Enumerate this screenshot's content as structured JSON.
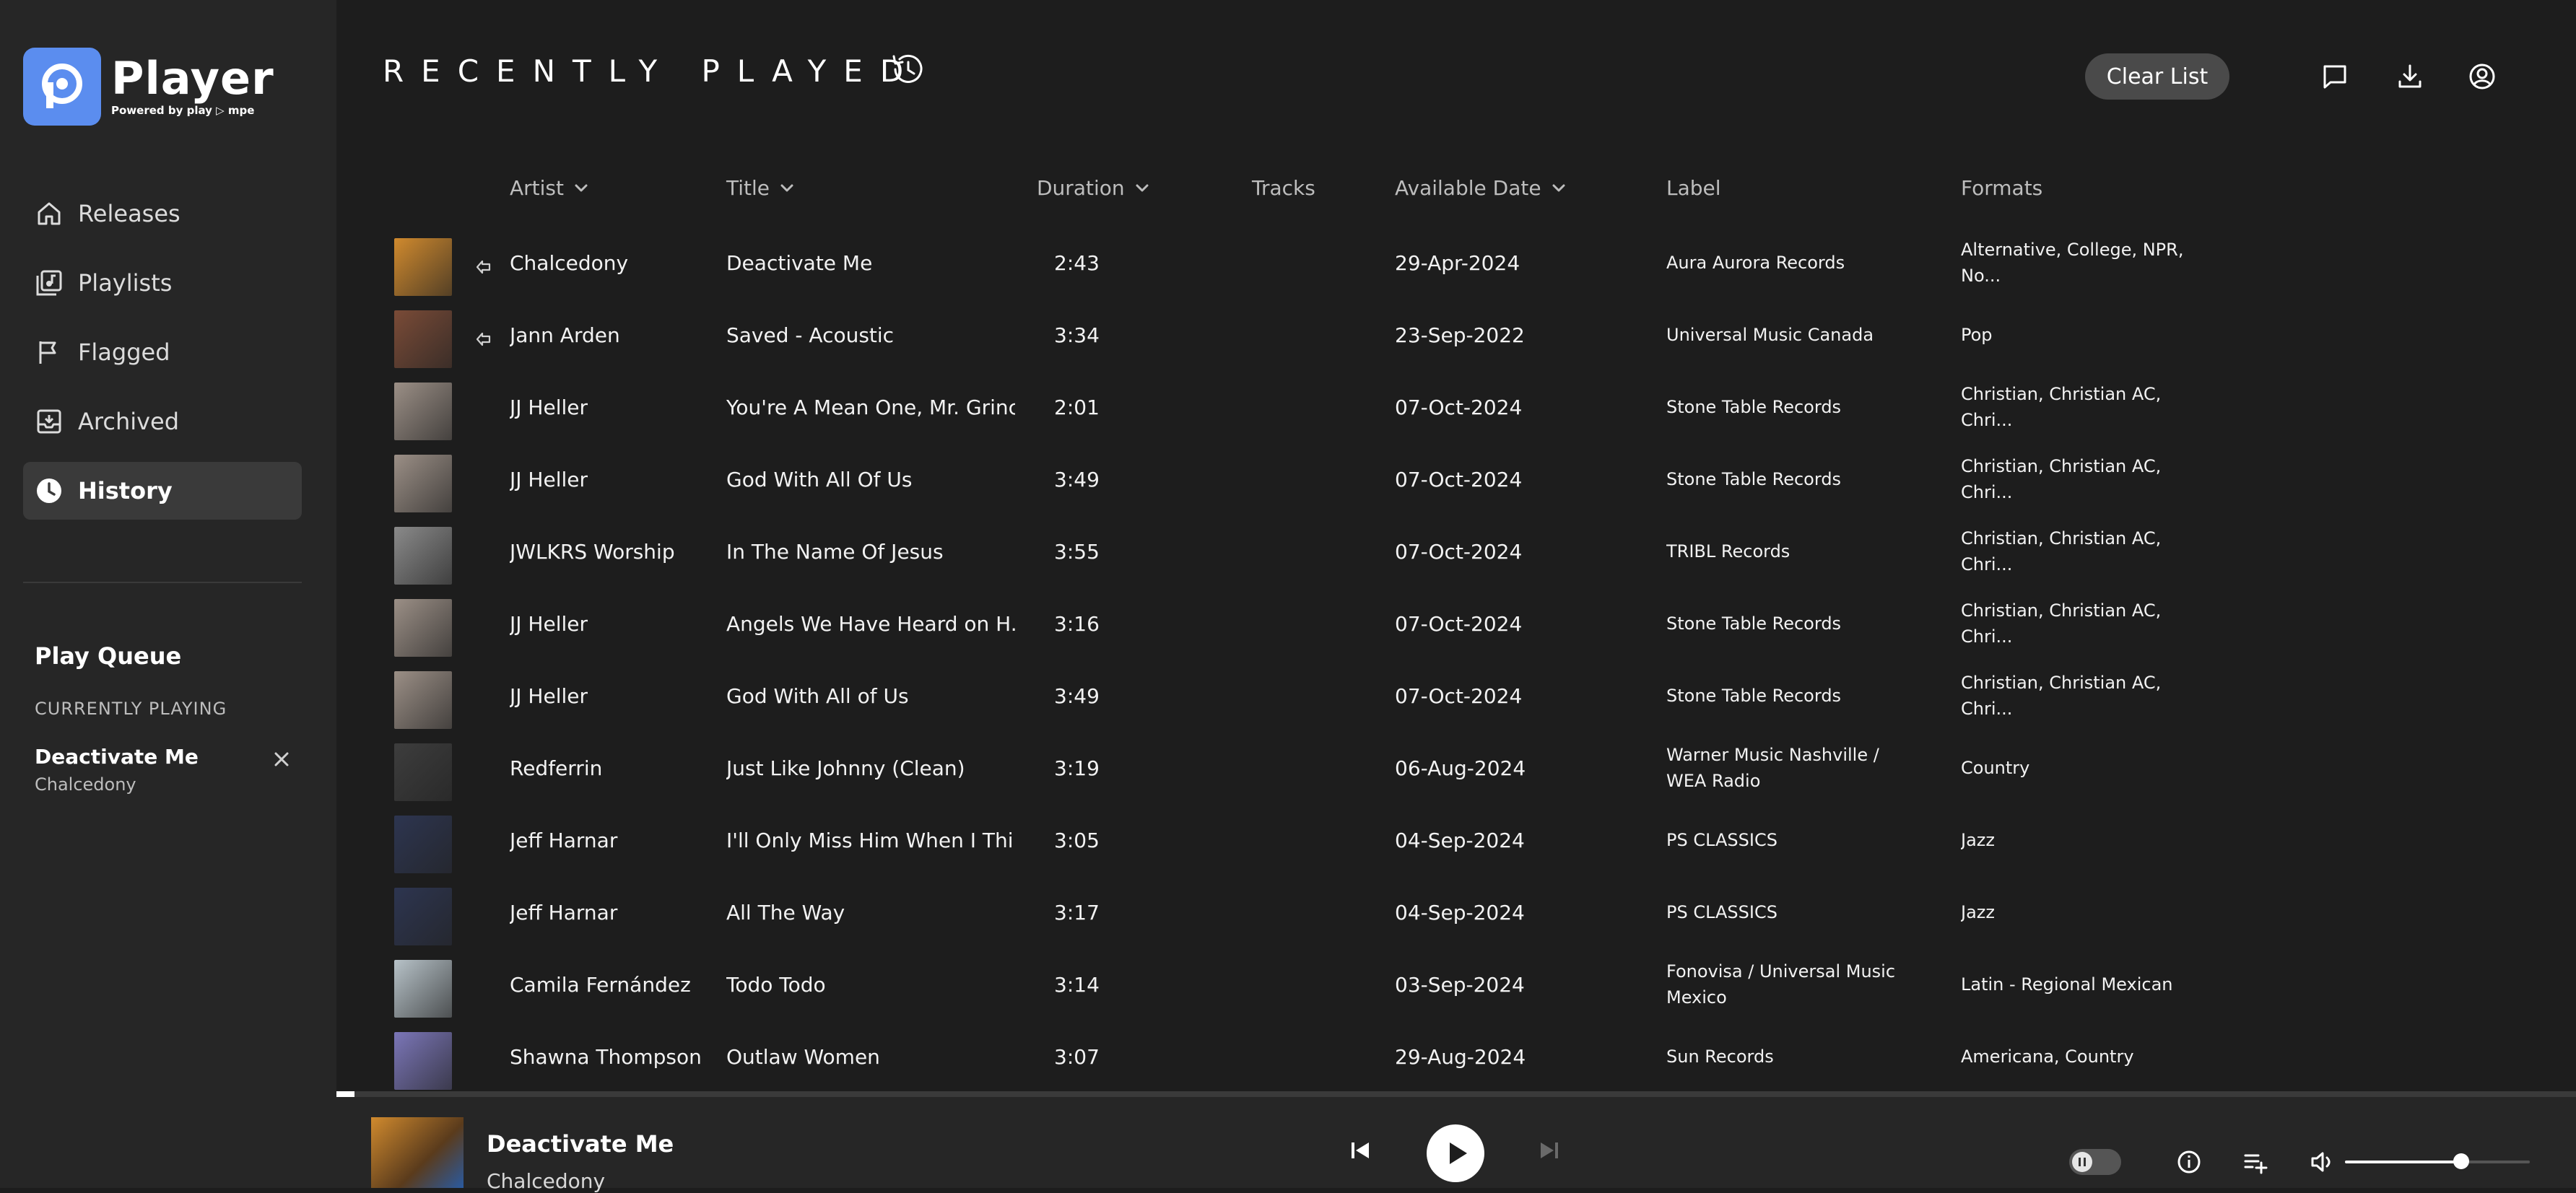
{
  "brand": {
    "name": "Player",
    "tagline": "Powered by play ▷ mpe",
    "accent": "#5b8def"
  },
  "sidebar": {
    "items": [
      {
        "label": "Releases",
        "icon": "home-icon",
        "active": false
      },
      {
        "label": "Playlists",
        "icon": "playlist-icon",
        "active": false
      },
      {
        "label": "Flagged",
        "icon": "flag-icon",
        "active": false
      },
      {
        "label": "Archived",
        "icon": "archive-icon",
        "active": false
      },
      {
        "label": "History",
        "icon": "clock-icon",
        "active": true
      }
    ],
    "queue": {
      "title": "Play Queue",
      "subtitle": "CURRENTLY PLAYING",
      "track_title": "Deactivate Me",
      "track_artist": "Chalcedony"
    }
  },
  "header": {
    "title": "RECENTLY PLAYED",
    "clear_label": "Clear List"
  },
  "table": {
    "columns": [
      {
        "key": "artist",
        "label": "Artist",
        "sortable": true
      },
      {
        "key": "title",
        "label": "Title",
        "sortable": true
      },
      {
        "key": "duration",
        "label": "Duration",
        "sortable": true
      },
      {
        "key": "tracks",
        "label": "Tracks",
        "sortable": false
      },
      {
        "key": "date",
        "label": "Available Date",
        "sortable": true
      },
      {
        "key": "label",
        "label": "Label",
        "sortable": false
      },
      {
        "key": "formats",
        "label": "Formats",
        "sortable": false
      }
    ],
    "rows": [
      {
        "artist": "Chalcedony",
        "title": "Deactivate Me",
        "duration": "2:43",
        "date": "29-Apr-2024",
        "label": "Aura Aurora Records",
        "formats": "Alternative, College, NPR, No...",
        "flag": true,
        "art": "#d08a2e"
      },
      {
        "artist": "Jann Arden",
        "title": "Saved - Acoustic",
        "duration": "3:34",
        "date": "23-Sep-2022",
        "label": "Universal Music Canada",
        "formats": "Pop",
        "flag": true,
        "art": "#7a4b37"
      },
      {
        "artist": "JJ Heller",
        "title": "You're A Mean One, Mr. Grinch",
        "duration": "2:01",
        "date": "07-Oct-2024",
        "label": "Stone Table Records",
        "formats": "Christian, Christian AC, Chri...",
        "flag": false,
        "art": "#9b8f86"
      },
      {
        "artist": "JJ Heller",
        "title": "God With All Of Us",
        "duration": "3:49",
        "date": "07-Oct-2024",
        "label": "Stone Table Records",
        "formats": "Christian, Christian AC, Chri...",
        "flag": false,
        "art": "#9b8f86"
      },
      {
        "artist": "JWLKRS Worship",
        "title": "In The Name Of Jesus",
        "duration": "3:55",
        "date": "07-Oct-2024",
        "label": "TRIBL Records",
        "formats": "Christian, Christian AC, Chri...",
        "flag": false,
        "art": "#8a8a8a"
      },
      {
        "artist": "JJ Heller",
        "title": "Angels We Have Heard on H...",
        "duration": "3:16",
        "date": "07-Oct-2024",
        "label": "Stone Table Records",
        "formats": "Christian, Christian AC, Chri...",
        "flag": false,
        "art": "#9b8f86"
      },
      {
        "artist": "JJ Heller",
        "title": "God With All of Us",
        "duration": "3:49",
        "date": "07-Oct-2024",
        "label": "Stone Table Records",
        "formats": "Christian, Christian AC, Chri...",
        "flag": false,
        "art": "#9b8f86"
      },
      {
        "artist": "Redferrin",
        "title": "Just Like Johnny (Clean)",
        "duration": "3:19",
        "date": "06-Aug-2024",
        "label": "Warner Music Nashville / WEA Radio",
        "formats": "Country",
        "flag": false,
        "art": "#3d3d3d"
      },
      {
        "artist": "Jeff Harnar",
        "title": "I'll Only Miss Him When I Thi...",
        "duration": "3:05",
        "date": "04-Sep-2024",
        "label": "PS CLASSICS",
        "formats": "Jazz",
        "flag": false,
        "art": "#2d3550"
      },
      {
        "artist": "Jeff Harnar",
        "title": "All The Way",
        "duration": "3:17",
        "date": "04-Sep-2024",
        "label": "PS CLASSICS",
        "formats": "Jazz",
        "flag": false,
        "art": "#2d3550"
      },
      {
        "artist": "Camila Fernández",
        "title": "Todo Todo",
        "duration": "3:14",
        "date": "03-Sep-2024",
        "label": "Fonovisa / Universal Music Mexico",
        "formats": "Latin - Regional Mexican",
        "flag": false,
        "art": "#b7c2c8"
      },
      {
        "artist": "Shawna Thompson",
        "title": "Outlaw Women",
        "duration": "3:07",
        "date": "29-Aug-2024",
        "label": "Sun Records",
        "formats": "Americana, Country",
        "flag": false,
        "art": "#7b76b8"
      }
    ]
  },
  "player": {
    "title": "Deactivate Me",
    "artist": "Chalcedony",
    "progress": 0.008,
    "volume": 0.63,
    "art": "#d08a2e"
  }
}
